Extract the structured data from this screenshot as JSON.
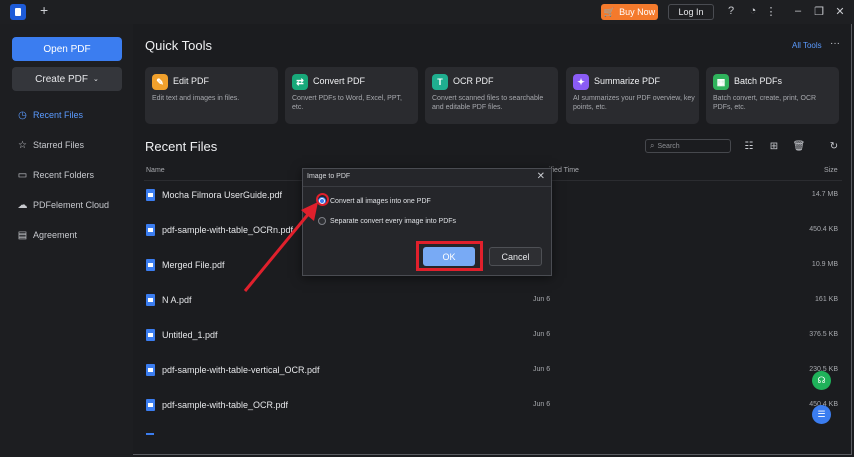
{
  "titlebar": {
    "new_tab": "+",
    "buy_now": "Buy Now",
    "login": "Log In",
    "icons": [
      "help-icon",
      "notification-icon",
      "more-icon",
      "minimize-icon",
      "restore-icon",
      "close-icon"
    ]
  },
  "sidebar": {
    "open_pdf": "Open PDF",
    "create_pdf": "Create PDF",
    "items": [
      {
        "label": "Recent Files",
        "icon": "clock-icon",
        "active": true
      },
      {
        "label": "Starred Files",
        "icon": "star-icon",
        "active": false
      },
      {
        "label": "Recent Folders",
        "icon": "folder-icon",
        "active": false
      },
      {
        "label": "PDFelement Cloud",
        "icon": "cloud-icon",
        "active": false
      },
      {
        "label": "Agreement",
        "icon": "agreement-icon",
        "active": false
      }
    ]
  },
  "quick_tools": {
    "title": "Quick Tools",
    "all_tools": "All Tools",
    "cards": [
      {
        "name": "Edit PDF",
        "desc": "Edit text and images in files.",
        "icon": "edit-pdf-icon",
        "color": "#f0a02c"
      },
      {
        "name": "Convert PDF",
        "desc": "Convert PDFs to Word, Excel, PPT, etc.",
        "icon": "convert-pdf-icon",
        "color": "#18a97a"
      },
      {
        "name": "OCR PDF",
        "desc": "Convert scanned files to searchable and editable PDF files.",
        "icon": "ocr-pdf-icon",
        "color": "#1fae8f"
      },
      {
        "name": "Summarize PDF",
        "desc": "AI summarizes your PDF overview, key points, etc.",
        "icon": "summarize-pdf-icon",
        "color": "#8a5cf6"
      },
      {
        "name": "Batch PDFs",
        "desc": "Batch convert, create, print, OCR PDFs, etc.",
        "icon": "batch-pdfs-icon",
        "color": "#2fb35c"
      }
    ]
  },
  "recent_files": {
    "title": "Recent Files",
    "search_placeholder": "Search",
    "columns": {
      "name": "Name",
      "modified": "ified Time",
      "size": "Size"
    },
    "files": [
      {
        "name": "Mocha Filmora UserGuide.pdf",
        "date": "",
        "size": "14.7 MB"
      },
      {
        "name": "pdf-sample-with-table_OCRn.pdf",
        "date": "",
        "size": "450.4 KB"
      },
      {
        "name": "Merged File.pdf",
        "date": "",
        "size": "10.9 MB"
      },
      {
        "name": "N A.pdf",
        "date": "Jun 6",
        "size": "161 KB"
      },
      {
        "name": "Untitled_1.pdf",
        "date": "Jun 6",
        "size": "376.5 KB"
      },
      {
        "name": "pdf-sample-with-table-vertical_OCR.pdf",
        "date": "Jun 6",
        "size": "230.5 KB"
      },
      {
        "name": "pdf-sample-with-table_OCR.pdf",
        "date": "Jun 6",
        "size": "450.4 KB"
      }
    ]
  },
  "dialog": {
    "title": "Image to PDF",
    "option1": "Convert all images into one PDF",
    "option2": "Separate convert every image into PDFs",
    "ok": "OK",
    "cancel": "Cancel",
    "selected_option": 1
  },
  "colors": {
    "accent": "#3b7df0",
    "highlight": "#e0202c",
    "buy": "#f47a2c"
  }
}
